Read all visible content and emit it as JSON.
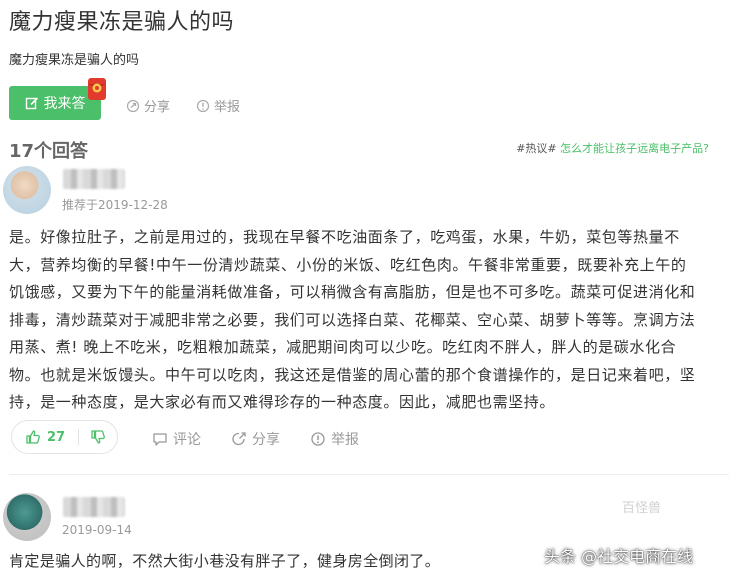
{
  "question": {
    "title": "魔力瘦果冻是骗人的吗",
    "description": "魔力瘦果冻是骗人的吗",
    "answer_button_label": "我来答",
    "share_label": "分享",
    "report_label": "举报"
  },
  "answers_header": {
    "count_label": "17个回答",
    "hot_tag": "#热议#",
    "hot_link": "怎么才能让孩子远离电子产品?"
  },
  "answers": [
    {
      "meta": "推荐于2019-12-28",
      "lines": [
        "是。好像拉肚子，之前是用过的，我现在早餐不吃油面条了，吃鸡蛋，水果，牛奶，菜包等热量不",
        "大，营养均衡的早餐!中午一份清炒蔬菜、小份的米饭、吃红色肉。午餐非常重要，既要补充上午的",
        "饥饿感，又要为下午的能量消耗做准备，可以稍微含有高脂肪，但是也不可多吃。蔬菜可促进消化和",
        "排毒，清炒蔬菜对于减肥非常之必要，我们可以选择白菜、花椰菜、空心菜、胡萝卜等等。烹调方法",
        "用蒸、煮! 晚上不吃米，吃粗粮加蔬菜，减肥期间肉可以少吃。吃红肉不胖人，胖人的是碳水化合",
        "物。也就是米饭馒头。中午可以吃肉，我这还是借鉴的周心蕾的那个食谱操作的，是日记来着吧，坚",
        "持，是一种态度，是大家必有而又难得珍存的一种态度。因此，减肥也需坚持。"
      ],
      "votes": "27",
      "comment_label": "评论",
      "share_label": "分享",
      "report_label": "举报"
    },
    {
      "meta": "2019-09-14",
      "text": "肯定是骗人的啊，不然大街小巷没有胖子了，健身房全倒闭了。"
    }
  ],
  "watermark": {
    "faint": "百怪兽",
    "main": "头条 @社交电商在线"
  },
  "colors": {
    "accent": "#4cbf6a",
    "muted": "#999999",
    "text": "#333333"
  }
}
